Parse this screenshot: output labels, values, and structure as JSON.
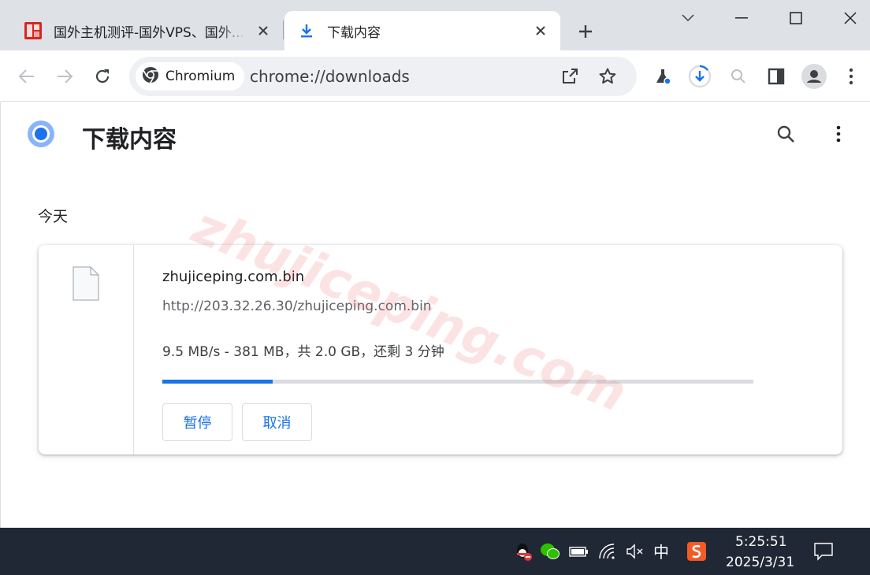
{
  "tabs": [
    {
      "title": "国外主机测评-国外VPS、国外...",
      "favicon": "site-seal-icon",
      "close": "close-icon"
    },
    {
      "title": "下载内容",
      "favicon": "download-icon",
      "close": "close-icon"
    }
  ],
  "toolbar": {
    "chip_label": "Chromium",
    "url": "chrome://downloads"
  },
  "page": {
    "title": "下载内容",
    "section": "今天"
  },
  "download": {
    "filename": "zhujiceping.com.bin",
    "url": "http://203.32.26.30/zhujiceping.com.bin",
    "status": "9.5 MB/s - 381 MB，共 2.0 GB，还剩 3 分钟",
    "progress_percent": 18.6,
    "pause_label": "暂停",
    "cancel_label": "取消"
  },
  "watermark": "zhujiceping.com",
  "taskbar": {
    "ime": "中",
    "time": "5:25:51",
    "date": "2025/3/31"
  },
  "colors": {
    "accent": "#1a73e8",
    "tabstrip": "#dee1e6",
    "taskbar": "#202836"
  }
}
